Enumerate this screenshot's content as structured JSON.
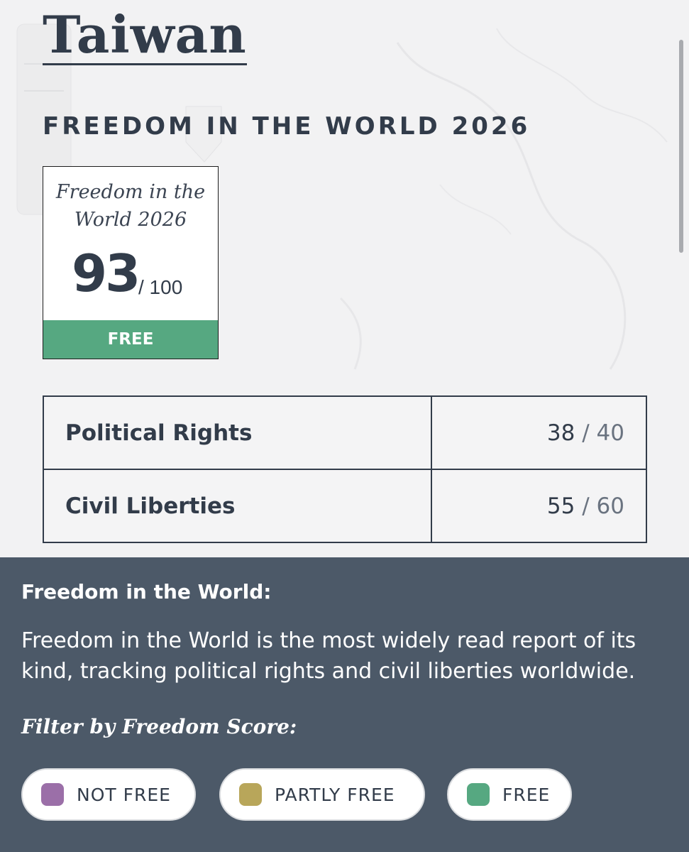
{
  "country": {
    "name": "Taiwan"
  },
  "report": {
    "heading": "FREEDOM IN THE WORLD 2026"
  },
  "score_card": {
    "title": "Freedom in the World 2026",
    "score": "93",
    "max": "/ 100",
    "status": "FREE",
    "status_color": "#56a881"
  },
  "scores_table": {
    "rows": [
      {
        "category": "Political Rights",
        "score": "38",
        "separator": "/",
        "max": "40"
      },
      {
        "category": "Civil Liberties",
        "score": "55",
        "separator": "/",
        "max": "60"
      }
    ]
  },
  "info": {
    "heading": "Freedom in the World:",
    "text": "Freedom in the World is the most widely read report of its kind, tracking political rights and civil liberties worldwide.",
    "filter_label": "Filter by Freedom Score:"
  },
  "filters": [
    {
      "label": "NOT FREE",
      "icon": "not-free-swatch-icon",
      "color": "#9b6fa8"
    },
    {
      "label": "PARTLY FREE",
      "icon": "partly-free-swatch-icon",
      "color": "#b8a65a"
    },
    {
      "label": "FREE",
      "icon": "free-swatch-icon",
      "color": "#56a881"
    }
  ],
  "colors": {
    "text": "#323c4a",
    "panel_background": "#4c5968",
    "page_background": "#f2f2f3"
  }
}
